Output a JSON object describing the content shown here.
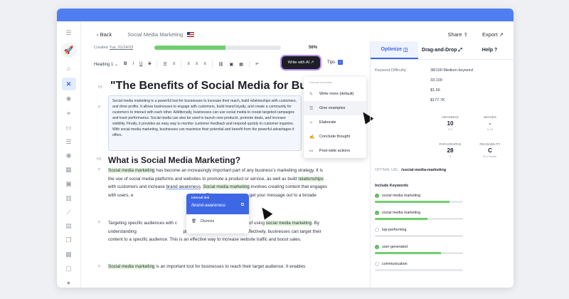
{
  "header": {
    "back_label": "Back",
    "doc_title": "Social Media Marketing",
    "share_label": "Share",
    "export_label": "Export"
  },
  "meta": {
    "created_label": "Created",
    "created_date": "Tue, 01/24/23",
    "progress_pct": 56,
    "progress_text": "56%"
  },
  "toolbar": {
    "heading_select": "Heading 1",
    "bold": "B",
    "italic": "I",
    "underline": "U",
    "strike": "S",
    "write_ai_label": "Write with AI",
    "tips_label": "Tips"
  },
  "editor": {
    "h1_tag": "H1",
    "p_tag": "P",
    "h2_tag": "H2",
    "title": "\"The Benefits of Social Media for Busin",
    "intro": "Social media marketing is a powerful tool for businesses to increase their reach, build relationships with customers, and drive profits. It allows businesses to engage with customers, build brand loyalty, and create a community for customers to interact with each other. Additionally, businesses can use social media to create targeted campaigns and track performance. Social media can also be used to launch new products, promote deals, and increase visibility. Finally, it provides an easy way to monitor customer feedback and respond quickly to customer inquiries. With social media marketing, businesses can maximize their potential and benefit from the powerful advantages it offers.",
    "h2": "What is Social Media Marketing?",
    "p1_hl": "Social media marketing",
    "p1_a": " has become an increasingly important part of any business's marketing strategy. It is the use of social media platforms and websites to promote a product or service, as well as build ",
    "p1_link": "relationships",
    "p1_b": " with customers and increase ",
    "p1_ul": "brand awareness",
    "p1_c": ". ",
    "p1_hl2": "Social media marketing",
    "p1_d": " involves creating content that engages with users, e",
    "p1_e": "ct with it. This is a great way to get your message out to a broade",
    "p2_a": "Targeting specific audiences with c",
    "p2_b": " other advantage of using ",
    "p2_hl": "social media marketing",
    "p2_c": ". By understanding",
    "p2_d": " platforms and how to use them effectively, businesses can target their content to a specific audience. This is an effective way to increase website traffic and boost sales.",
    "p3_hl": "Social media marketing",
    "p3_a": " is an important tool for businesses to reach their target audience. It enables"
  },
  "ai_menu": {
    "heading": "Choose a function",
    "items": [
      "Write more (default)",
      "Give examples",
      "Elaborate",
      "Conclude thought",
      "Post-wide actions"
    ]
  },
  "link_popup": {
    "label": "Internal link",
    "url": "/brand-awareness",
    "dismiss": "Dismiss"
  },
  "right_panel": {
    "tabs": [
      "Optimize",
      "Drag-and-Drop",
      "Help"
    ],
    "difficulty_label": "Keyword Difficulty:",
    "difficulty_value": "38/100 Medium keyword",
    "volume_value": "33,100",
    "value2": "$1.56",
    "value3": "$177.7K",
    "headings_label": "HEADINGS",
    "headings_value": "10",
    "headings_range": "3-9",
    "images_label": "IMAGES",
    "images_value": "-",
    "images_range": "6-16",
    "paragraphs_label": "PARAGRAPHS",
    "paragraphs_value": "28",
    "paragraphs_range": "6",
    "readability_label": "READABILITY",
    "readability_value": "C",
    "readability_range": "B or better",
    "url_label": "OPTIMAL URL",
    "url_value": "/social-media-marketing",
    "keywords_title": "Include Keywords",
    "keywords": [
      {
        "name": "social media marketing",
        "done": true,
        "fill": 0.85
      },
      {
        "name": "social media marketing",
        "done": true,
        "fill": 0.6
      },
      {
        "name": "top-performing",
        "done": false,
        "fill": 0.0
      },
      {
        "name": "user-generated",
        "done": true,
        "fill": 0.75
      },
      {
        "name": "communication",
        "done": false,
        "fill": 0.0
      }
    ]
  }
}
